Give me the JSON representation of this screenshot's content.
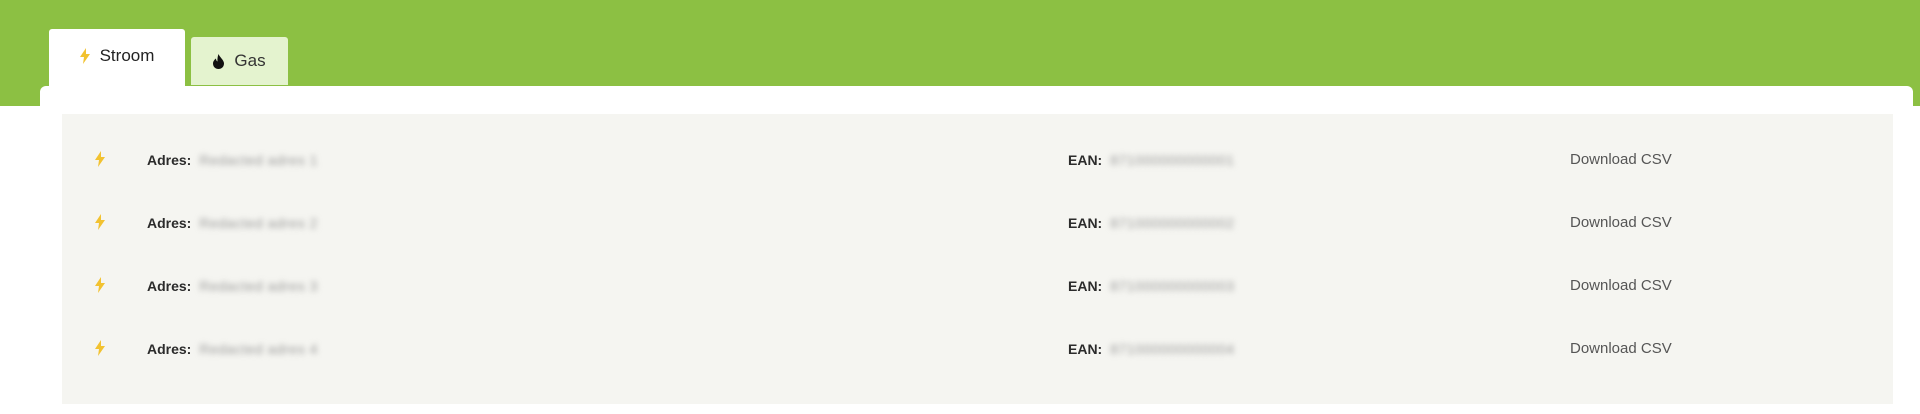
{
  "tabs": [
    {
      "label": "Stroom",
      "icon": "bolt-icon",
      "active": true
    },
    {
      "label": "Gas",
      "icon": "flame-icon",
      "active": false
    }
  ],
  "colors": {
    "brand_green": "#8cc043",
    "inactive_tab": "#e4f3cf",
    "list_background": "#f5f5f1",
    "bolt": "#f2c230"
  },
  "connections": [
    {
      "icon": "bolt-icon",
      "adres_label": "Adres:",
      "adres_value": "Redacted adres 1",
      "ean_label": "EAN:",
      "ean_value": "871000000000001",
      "download_label": "Download CSV"
    },
    {
      "icon": "bolt-icon",
      "adres_label": "Adres:",
      "adres_value": "Redacted adres 2",
      "ean_label": "EAN:",
      "ean_value": "871000000000002",
      "download_label": "Download CSV"
    },
    {
      "icon": "bolt-icon",
      "adres_label": "Adres:",
      "adres_value": "Redacted adres 3",
      "ean_label": "EAN:",
      "ean_value": "871000000000003",
      "download_label": "Download CSV"
    },
    {
      "icon": "bolt-icon",
      "adres_label": "Adres:",
      "adres_value": "Redacted adres 4",
      "ean_label": "EAN:",
      "ean_value": "871000000000004",
      "download_label": "Download CSV"
    }
  ]
}
